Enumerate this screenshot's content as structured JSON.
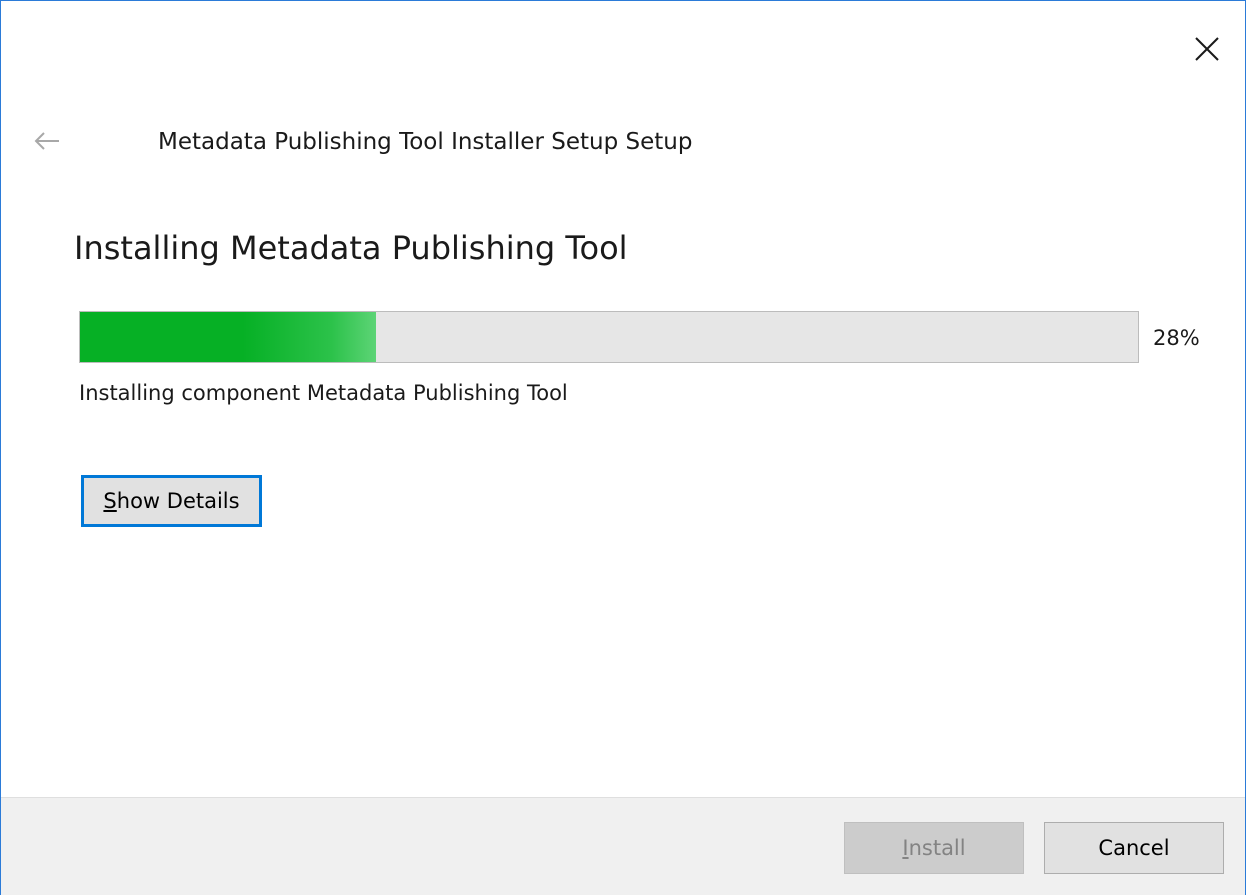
{
  "window": {
    "title": "Metadata Publishing Tool Installer Setup Setup",
    "close_icon": "close-icon",
    "back_icon": "back-arrow-icon"
  },
  "main": {
    "heading": "Installing Metadata Publishing Tool",
    "progress": {
      "value": 0.28,
      "label": "28%",
      "fill_color": "#06b025"
    },
    "status": "Installing component Metadata Publishing Tool",
    "details_button": {
      "mnemonic": "S",
      "rest": "how Details"
    }
  },
  "footer": {
    "install_button": {
      "mnemonic": "I",
      "rest": "nstall",
      "enabled": false
    },
    "cancel_button": {
      "label": "Cancel"
    }
  },
  "colors": {
    "accent": "#0078d7",
    "progress": "#06b025"
  }
}
